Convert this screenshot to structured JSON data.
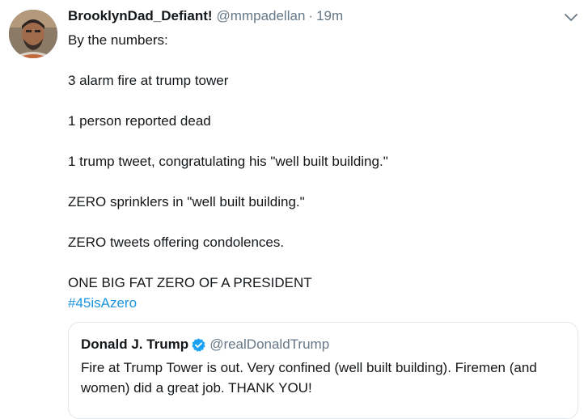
{
  "tweet": {
    "display_name": "BrooklynDad_Defiant!",
    "handle": "@mmpadellan",
    "separator": "·",
    "time": "19m",
    "lines": [
      "By the numbers:",
      "3 alarm fire at trump tower",
      "1 person reported dead",
      "1 trump tweet, congratulating his \"well built building.\"",
      "ZERO sprinklers in \"well built building.\"",
      "ZERO tweets offering condolences.",
      "ONE BIG FAT ZERO OF A PRESIDENT"
    ],
    "hashtag": "#45isAzero"
  },
  "quoted_tweet": {
    "display_name": "Donald J. Trump",
    "handle": "@realDonaldTrump",
    "verified": true,
    "text_line_1": "Fire at Trump Tower is out. Very confined (well built building). Firemen (and",
    "text_line_2": "women) did a great job. THANK YOU!"
  },
  "icons": {
    "avatar": "user-avatar",
    "menu": "chevron-down-icon",
    "verified": "verified-badge-icon"
  },
  "colors": {
    "text": "#14171a",
    "secondary": "#657786",
    "link": "#1b95e0",
    "verified": "#1da1f2",
    "border": "#e1e8ed"
  }
}
